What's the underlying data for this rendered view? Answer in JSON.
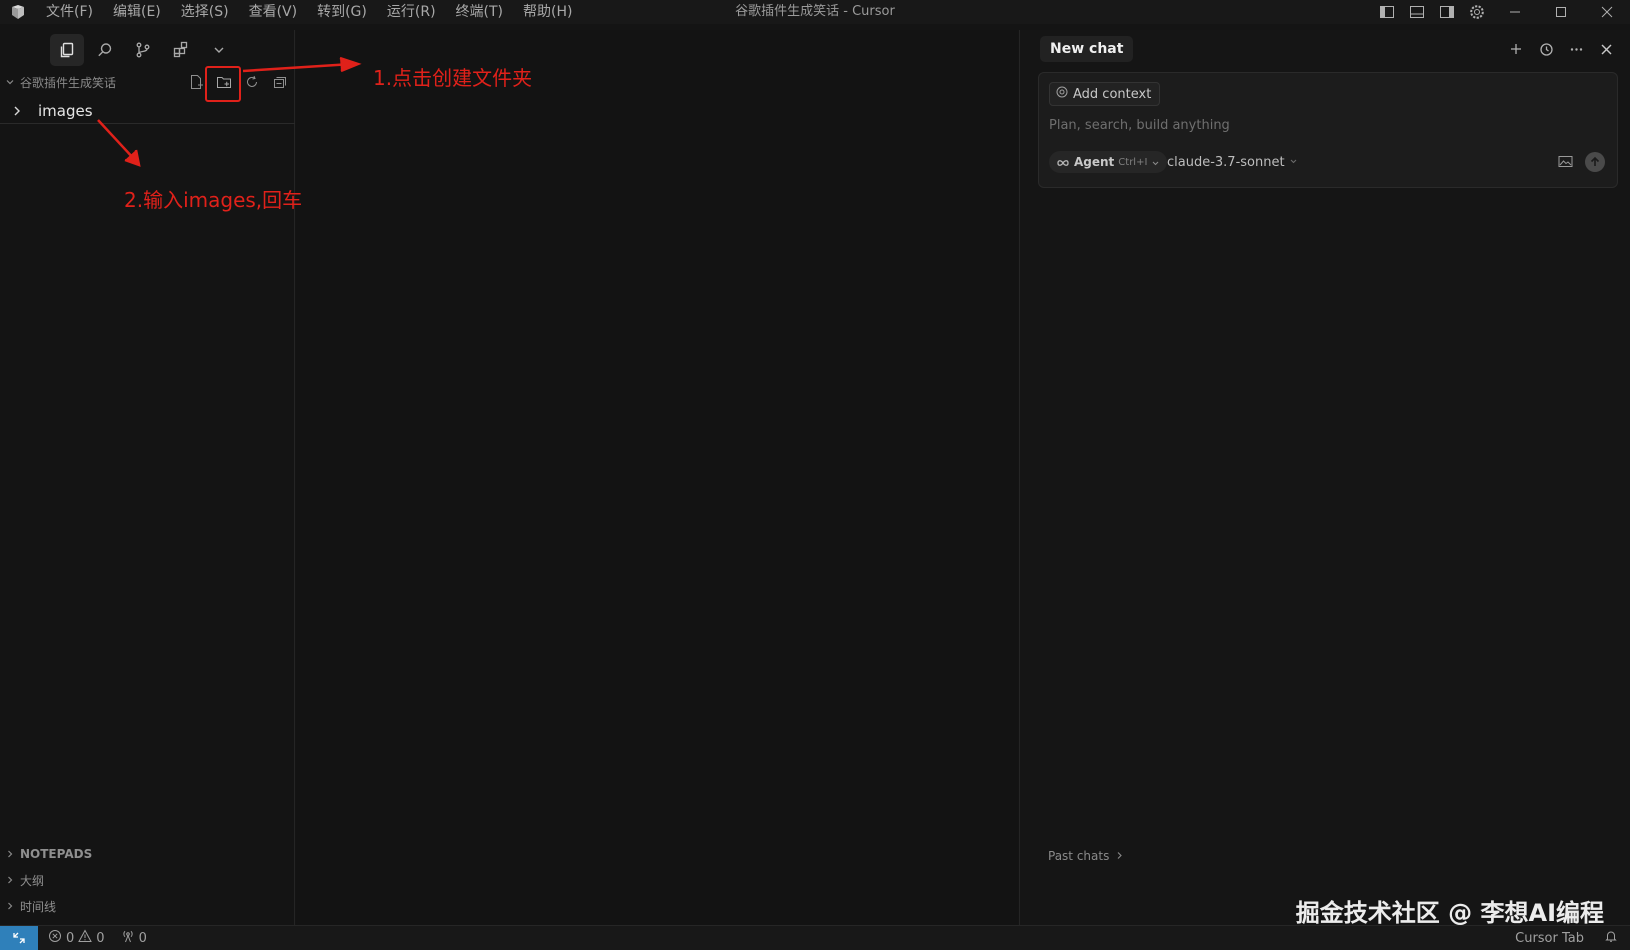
{
  "titlebar": {
    "menu": [
      {
        "label": "文件(F)"
      },
      {
        "label": "编辑(E)"
      },
      {
        "label": "选择(S)"
      },
      {
        "label": "查看(V)"
      },
      {
        "label": "转到(G)"
      },
      {
        "label": "运行(R)"
      },
      {
        "label": "终端(T)"
      },
      {
        "label": "帮助(H)"
      }
    ],
    "title": "谷歌插件生成笑话 - Cursor"
  },
  "sidebar": {
    "explorer_title": "谷歌插件生成笑话",
    "tree": [
      {
        "label": "images",
        "type": "folder"
      }
    ],
    "sections": [
      {
        "label": "NOTEPADS"
      },
      {
        "label": "大纲"
      },
      {
        "label": "时间线"
      }
    ]
  },
  "chat": {
    "tab_label": "New chat",
    "add_context_label": "Add context",
    "input_placeholder": "Plan, search, build anything",
    "agent_label": "Agent",
    "agent_shortcut": "Ctrl+I",
    "model": "claude-3.7-sonnet",
    "past_chats_label": "Past chats"
  },
  "statusbar": {
    "errors": "0",
    "warnings": "0",
    "ports": "0",
    "cursor_tab_label": "Cursor Tab"
  },
  "annotations": {
    "step1": "1.点击创建文件夹",
    "step2": "2.输入images,回车",
    "color": "#e0211a"
  },
  "watermark": "掘金技术社区 @ 李想AI编程",
  "colors": {
    "background": "#141414",
    "status_remote": "#2f80ba",
    "annotation_red": "#e0211a"
  }
}
